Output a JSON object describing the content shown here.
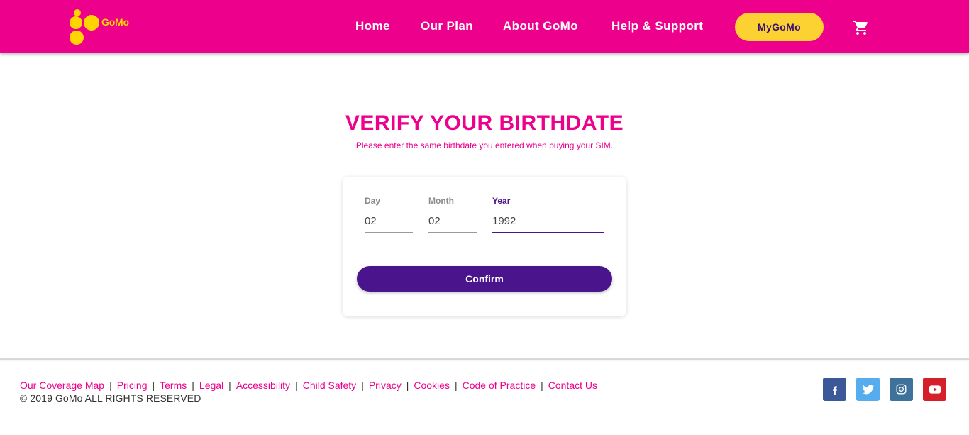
{
  "header": {
    "logo_text": "GoMo",
    "nav": [
      "Home",
      "Our Plan",
      "About GoMo",
      "Help & Support"
    ],
    "mygomo_label": "MyGoMo",
    "cart_icon": "shopping-cart-icon"
  },
  "main": {
    "title": "VERIFY YOUR BIRTHDATE",
    "subtitle": "Please enter the same birthdate you entered when buying your SIM.",
    "fields": {
      "day": {
        "label": "Day",
        "value": "02"
      },
      "month": {
        "label": "Month",
        "value": "02"
      },
      "year": {
        "label": "Year",
        "value": "1992"
      }
    },
    "confirm_label": "Confirm"
  },
  "footer": {
    "links": [
      "Our Coverage Map",
      "Pricing",
      "Terms",
      "Legal",
      "Accessibility",
      "Child Safety",
      "Privacy",
      "Cookies",
      "Code of Practice",
      "Contact Us"
    ],
    "separator": "|",
    "copyright": "© 2019 GoMo ALL RIGHTS RESERVED",
    "social": [
      "facebook-icon",
      "twitter-icon",
      "instagram-icon",
      "youtube-icon"
    ]
  },
  "colors": {
    "brand_pink": "#ec008c",
    "brand_yellow": "#ffd400",
    "button_yellow": "#fcd233",
    "brand_purple": "#4a148c"
  }
}
